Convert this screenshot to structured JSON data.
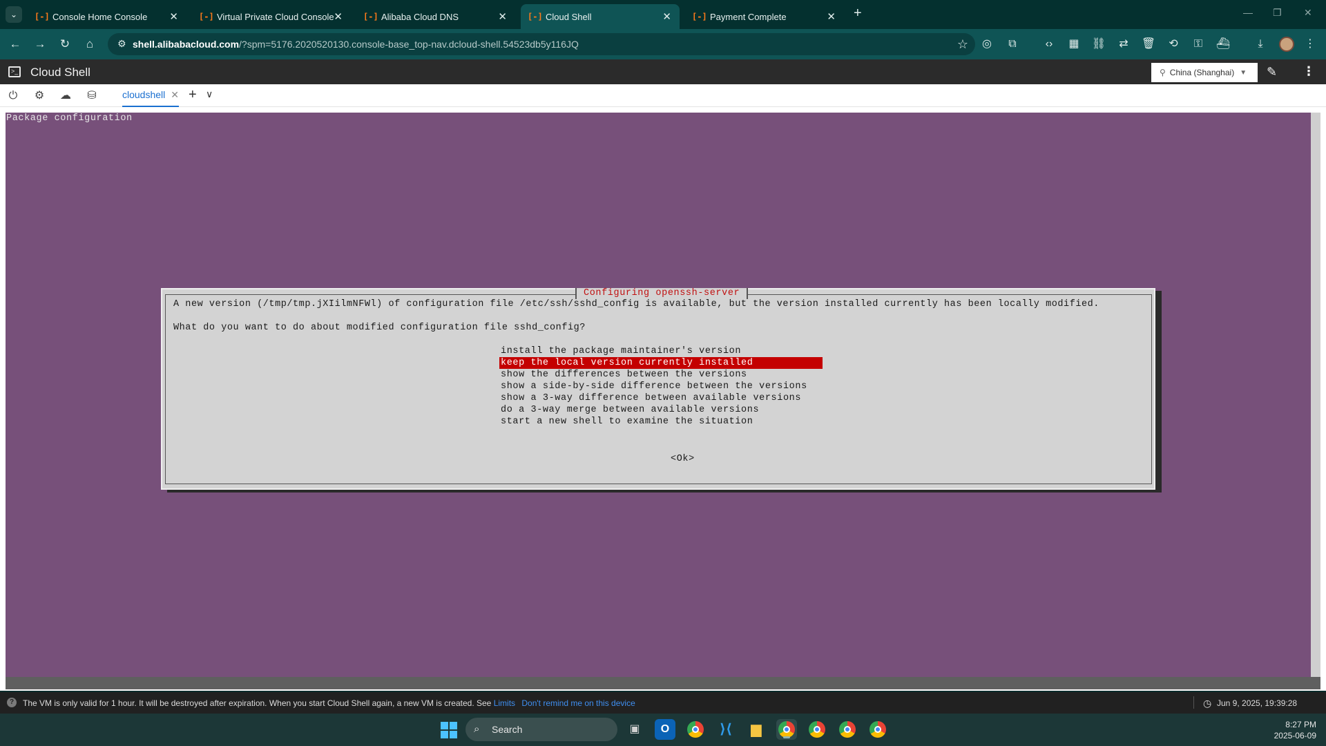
{
  "browser": {
    "tabs": [
      {
        "label": "Console Home Console",
        "active": false
      },
      {
        "label": "Virtual Private Cloud Console",
        "active": false
      },
      {
        "label": "Alibaba Cloud DNS",
        "active": false
      },
      {
        "label": "Cloud Shell",
        "active": true
      },
      {
        "label": "Payment Complete",
        "active": false
      }
    ],
    "url_host": "shell.alibabacloud.com",
    "url_rest": "/?spm=5176.2020520130.console-base_top-nav.dcloud-shell.54523db5y116JQ"
  },
  "cloudshell": {
    "title": "Cloud Shell",
    "region": "China (Shanghai)",
    "session_tab": "cloudshell"
  },
  "terminal": {
    "header": "Package configuration",
    "dialog_title": "Configuring openssh-server",
    "message_1": "A new version (/tmp/tmp.jXIilmNFWl) of configuration file /etc/ssh/sshd_config is available, but the version installed currently has been locally modified.",
    "message_2": "What do you want to do about modified configuration file sshd_config?",
    "choices": [
      "install the package maintainer's version",
      "keep the local version currently installed",
      "show the differences between the versions",
      "show a side-by-side difference between the versions",
      "show a 3-way difference between available versions",
      "do a 3-way merge between available versions",
      "start a new shell to examine the situation"
    ],
    "selected_index": 1,
    "ok_label": "<Ok>"
  },
  "notice": {
    "text": "The VM is only valid for 1 hour. It will be destroyed after expiration. When you start Cloud Shell again, a new VM is created. See",
    "link": "Limits",
    "dismiss": "Don't remind me on this device",
    "timestamp": "Jun 9, 2025, 19:39:28"
  },
  "taskbar": {
    "search_label": "Search",
    "time": "8:27 PM",
    "date": "2025-06-09"
  },
  "colors": {
    "terminal_bg": "#77507a",
    "dialog_bg": "#d3d3d3",
    "selection": "#c40000",
    "title_red": "#c01010"
  }
}
